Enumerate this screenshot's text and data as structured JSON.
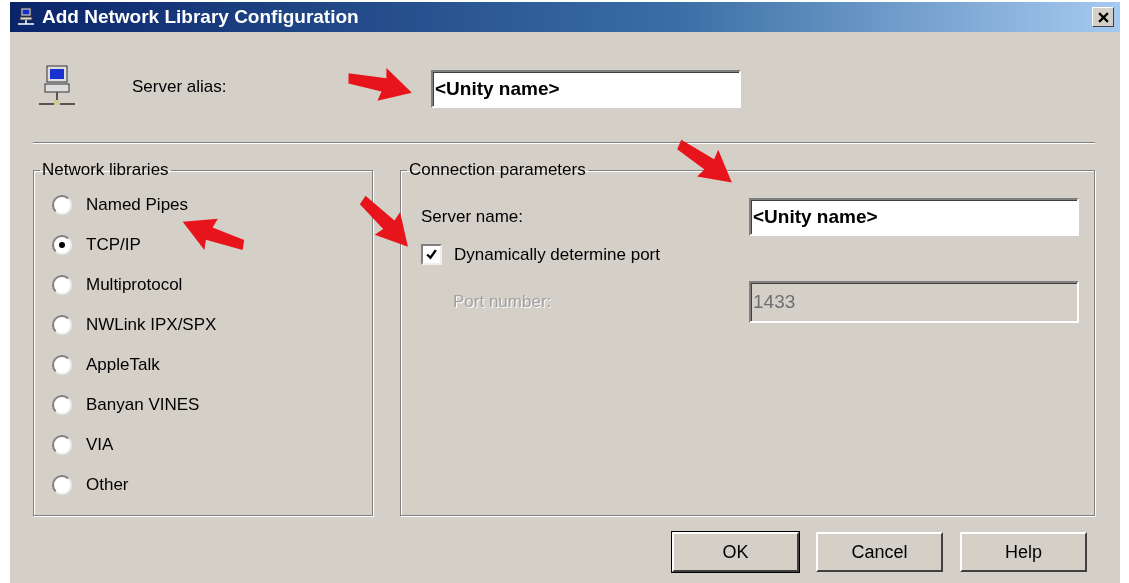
{
  "window": {
    "title": "Add Network Library Configuration"
  },
  "server_alias": {
    "label": "Server alias:",
    "value": "<Unity name>"
  },
  "network_libraries": {
    "title": "Network libraries",
    "options": [
      {
        "label": "Named Pipes",
        "selected": false
      },
      {
        "label": "TCP/IP",
        "selected": true
      },
      {
        "label": "Multiprotocol",
        "selected": false
      },
      {
        "label": "NWLink IPX/SPX",
        "selected": false
      },
      {
        "label": "AppleTalk",
        "selected": false
      },
      {
        "label": "Banyan VINES",
        "selected": false
      },
      {
        "label": "VIA",
        "selected": false
      },
      {
        "label": "Other",
        "selected": false
      }
    ]
  },
  "connection_parameters": {
    "title": "Connection parameters",
    "server_name": {
      "label": "Server name:",
      "value": "<Unity name>"
    },
    "dynamic_port": {
      "label": "Dynamically determine port",
      "checked": true
    },
    "port_number": {
      "label": "Port number:",
      "value": "1433",
      "disabled": true
    }
  },
  "buttons": [
    {
      "label": "OK",
      "default": true
    },
    {
      "label": "Cancel",
      "default": false
    },
    {
      "label": "Help",
      "default": false
    }
  ]
}
